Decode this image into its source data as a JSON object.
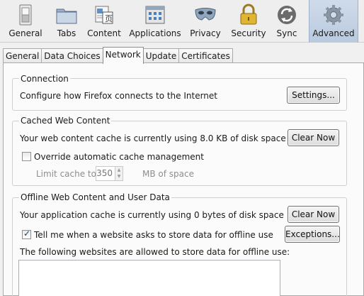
{
  "panes": [
    {
      "id": "general",
      "label": "General",
      "icon": "switch-icon"
    },
    {
      "id": "tabs",
      "label": "Tabs",
      "icon": "folder-tabs-icon"
    },
    {
      "id": "content",
      "label": "Content",
      "icon": "content-page-icon"
    },
    {
      "id": "applications",
      "label": "Applications",
      "icon": "applications-window-icon"
    },
    {
      "id": "privacy",
      "label": "Privacy",
      "icon": "privacy-mask-icon"
    },
    {
      "id": "security",
      "label": "Security",
      "icon": "padlock-icon"
    },
    {
      "id": "sync",
      "label": "Sync",
      "icon": "sync-arrows-icon"
    },
    {
      "id": "advanced",
      "label": "Advanced",
      "icon": "gear-icon",
      "active": true
    }
  ],
  "subtabs": [
    "General",
    "Data Choices",
    "Network",
    "Update",
    "Certificates"
  ],
  "selected_subtab": "Network",
  "connection": {
    "title": "Connection",
    "description": "Configure how Firefox connects to the Internet",
    "settings_button": "Settings..."
  },
  "cache": {
    "title": "Cached Web Content",
    "description": "Your web content cache is currently using 8.0 KB of disk space",
    "clear_button": "Clear Now",
    "override_label": "Override automatic cache management",
    "override_checked": false,
    "limit_label": "Limit cache to",
    "limit_value": "350",
    "limit_unit": "MB of space"
  },
  "offline": {
    "title": "Offline Web Content and User Data",
    "description": "Your application cache is currently using 0 bytes of disk space",
    "clear_button": "Clear Now",
    "tell_me_label": "Tell me when a website asks to store data for offline use",
    "tell_me_checked": true,
    "exceptions_button": "Exceptions...",
    "allowed_label": "The following websites are allowed to store data for offline use:"
  },
  "colors": {
    "active_pane": "#c2d2e5",
    "window_bg": "#f0f0f0",
    "panel_bg": "#fbfbfb"
  }
}
